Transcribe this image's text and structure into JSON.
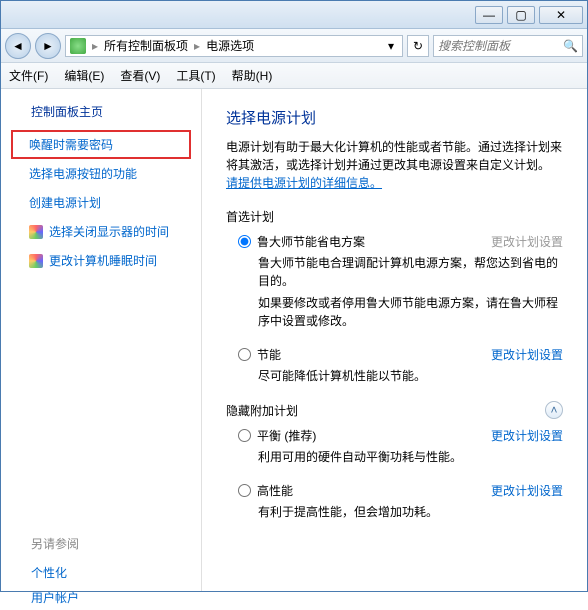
{
  "winbtns": {
    "min": "—",
    "max": "▢",
    "close": "✕"
  },
  "nav": {
    "back": "◄",
    "fwd": "►",
    "crumb1": "所有控制面板项",
    "crumb2": "电源选项",
    "drop": "▾",
    "refresh": "↻"
  },
  "search": {
    "placeholder": "搜索控制面板",
    "icon": "🔍"
  },
  "menu": {
    "file": "文件(F)",
    "edit": "编辑(E)",
    "view": "查看(V)",
    "tools": "工具(T)",
    "help": "帮助(H)"
  },
  "sidebar": {
    "head": "控制面板主页",
    "links": [
      {
        "label": "唤醒时需要密码",
        "hl": true
      },
      {
        "label": "选择电源按钮的功能"
      },
      {
        "label": "创建电源计划"
      },
      {
        "label": "选择关闭显示器的时间",
        "shield": true
      },
      {
        "label": "更改计算机睡眠时间",
        "shield": true
      }
    ],
    "seealso": {
      "head": "另请参阅",
      "a": "个性化",
      "b": "用户帐户"
    }
  },
  "main": {
    "title": "选择电源计划",
    "desc1": "电源计划有助于最大化计算机的性能或者节能。通过选择计划来将其激活，或选择计划并通过更改其电源设置来自定义计划。",
    "desc_link": "请提供电源计划的详细信息。",
    "section1": "首选计划",
    "section2": "隐藏附加计划",
    "expand": "˄",
    "change": "更改计划设置",
    "plans": {
      "ludashi": {
        "name": "鲁大师节能省电方案",
        "desc": "鲁大师节能电合理调配计算机电源方案，帮您达到省电的目的。",
        "desc2": "如果要修改或者停用鲁大师节能电源方案，请在鲁大师程序中设置或修改。"
      },
      "saver": {
        "name": "节能",
        "desc": "尽可能降低计算机性能以节能。"
      },
      "balanced": {
        "name": "平衡 (推荐)",
        "desc": "利用可用的硬件自动平衡功耗与性能。"
      },
      "high": {
        "name": "高性能",
        "desc": "有利于提高性能，但会增加功耗。"
      }
    }
  }
}
